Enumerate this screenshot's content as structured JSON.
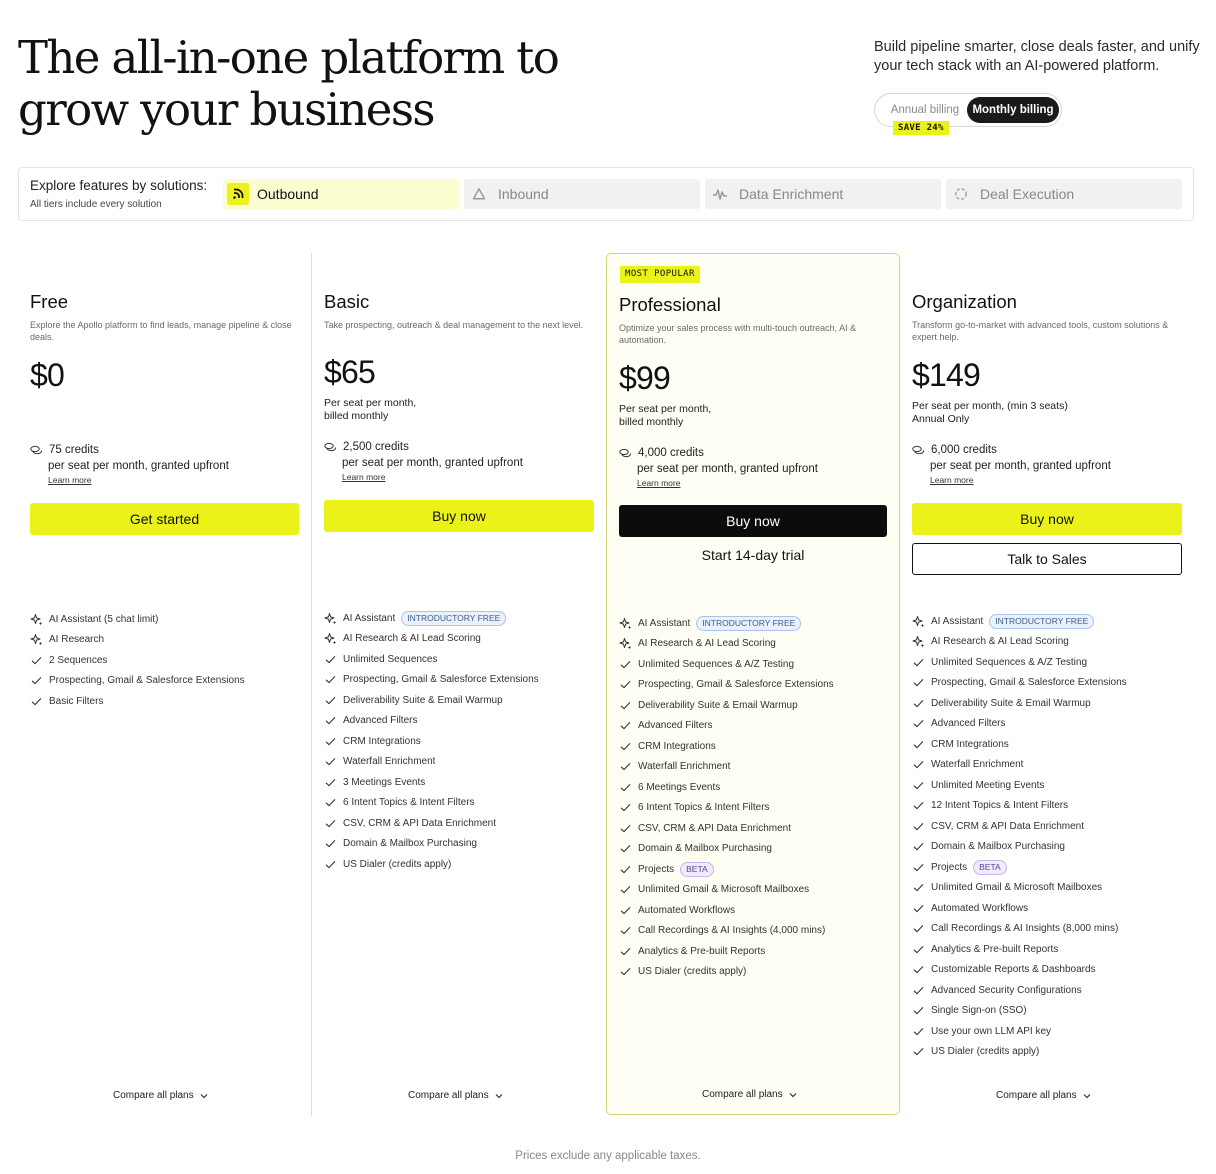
{
  "hero": {
    "title": "The all-in-one platform to grow your business",
    "subtitle": "Build pipeline smarter, close deals faster, and unify your tech stack with an AI-powered platform."
  },
  "billing": {
    "annual_label": "Annual billing",
    "monthly_label": "Monthly billing",
    "selected": "Monthly billing",
    "save_badge": "SAVE 24%"
  },
  "explore": {
    "title": "Explore features by solutions:",
    "note": "All tiers include every solution",
    "tabs": [
      {
        "label": "Outbound",
        "icon": "outbound-icon",
        "active": true
      },
      {
        "label": "Inbound",
        "icon": "inbound-icon",
        "active": false
      },
      {
        "label": "Data Enrichment",
        "icon": "data-enrichment-icon",
        "active": false
      },
      {
        "label": "Deal Execution",
        "icon": "deal-execution-icon",
        "active": false
      }
    ]
  },
  "plans": [
    {
      "name": "Free",
      "description": "Explore the Apollo platform to find leads, manage pipeline & close deals.",
      "price": "$0",
      "billed": "",
      "credits": "75 credits",
      "credits_note": "per seat per month, granted upfront",
      "learn_more": "Learn more",
      "primary_button": "Get started",
      "secondary_button": "",
      "compare": "Compare all plans",
      "features": [
        {
          "text": "AI Assistant (5 chat limit)",
          "icon": "sparkle-icon",
          "tag": ""
        },
        {
          "text": "AI Research",
          "icon": "sparkle-icon",
          "tag": ""
        },
        {
          "text": "2 Sequences",
          "icon": "check-icon",
          "tag": ""
        },
        {
          "text": "Prospecting, Gmail & Salesforce Extensions",
          "icon": "check-icon",
          "tag": ""
        },
        {
          "text": "Basic Filters",
          "icon": "check-icon",
          "tag": ""
        }
      ]
    },
    {
      "name": "Basic",
      "description": "Take prospecting, outreach & deal management to the next level.",
      "price": "$65",
      "billed": "Per seat per month,\nbilled monthly",
      "credits": "2,500 credits",
      "credits_note": "per seat per month, granted upfront",
      "learn_more": "Learn more",
      "primary_button": "Buy now",
      "secondary_button": "",
      "compare": "Compare all plans",
      "features": [
        {
          "text": "AI Assistant",
          "icon": "sparkle-icon",
          "tag": "INTRODUCTORY FREE"
        },
        {
          "text": "AI Research & AI Lead Scoring",
          "icon": "sparkle-icon",
          "tag": ""
        },
        {
          "text": "Unlimited Sequences",
          "icon": "check-icon",
          "tag": ""
        },
        {
          "text": "Prospecting, Gmail & Salesforce Extensions",
          "icon": "check-icon",
          "tag": ""
        },
        {
          "text": "Deliverability Suite & Email Warmup",
          "icon": "check-icon",
          "tag": ""
        },
        {
          "text": "Advanced Filters",
          "icon": "check-icon",
          "tag": ""
        },
        {
          "text": "CRM Integrations",
          "icon": "check-icon",
          "tag": ""
        },
        {
          "text": "Waterfall Enrichment",
          "icon": "check-icon",
          "tag": ""
        },
        {
          "text": "3 Meetings Events",
          "icon": "check-icon",
          "tag": ""
        },
        {
          "text": "6 Intent Topics & Intent Filters",
          "icon": "check-icon",
          "tag": ""
        },
        {
          "text": "CSV, CRM & API Data Enrichment",
          "icon": "check-icon",
          "tag": ""
        },
        {
          "text": "Domain & Mailbox Purchasing",
          "icon": "check-icon",
          "tag": ""
        },
        {
          "text": "US Dialer (credits apply)",
          "icon": "check-icon",
          "tag": ""
        }
      ]
    },
    {
      "name": "Professional",
      "badge": "MOST POPULAR",
      "description": "Optimize your sales process with multi-touch outreach, AI & automation.",
      "price": "$99",
      "billed": "Per seat per month,\nbilled monthly",
      "credits": "4,000 credits",
      "credits_note": "per seat per month, granted upfront",
      "learn_more": "Learn more",
      "primary_button": "Buy now",
      "secondary_button": "Start 14-day trial",
      "compare": "Compare all plans",
      "features": [
        {
          "text": "AI Assistant",
          "icon": "sparkle-icon",
          "tag": "INTRODUCTORY FREE"
        },
        {
          "text": "AI Research & AI Lead Scoring",
          "icon": "sparkle-icon",
          "tag": ""
        },
        {
          "text": "Unlimited Sequences & A/Z Testing",
          "icon": "check-icon",
          "tag": ""
        },
        {
          "text": "Prospecting, Gmail & Salesforce Extensions",
          "icon": "check-icon",
          "tag": ""
        },
        {
          "text": "Deliverability Suite & Email Warmup",
          "icon": "check-icon",
          "tag": ""
        },
        {
          "text": "Advanced Filters",
          "icon": "check-icon",
          "tag": ""
        },
        {
          "text": "CRM Integrations",
          "icon": "check-icon",
          "tag": ""
        },
        {
          "text": "Waterfall Enrichment",
          "icon": "check-icon",
          "tag": ""
        },
        {
          "text": "6 Meetings Events",
          "icon": "check-icon",
          "tag": ""
        },
        {
          "text": "6 Intent Topics & Intent Filters",
          "icon": "check-icon",
          "tag": ""
        },
        {
          "text": "CSV, CRM & API Data Enrichment",
          "icon": "check-icon",
          "tag": ""
        },
        {
          "text": "Domain & Mailbox Purchasing",
          "icon": "check-icon",
          "tag": ""
        },
        {
          "text": "Projects",
          "icon": "check-icon",
          "tag": "BETA"
        },
        {
          "text": "Unlimited Gmail & Microsoft Mailboxes",
          "icon": "check-icon",
          "tag": ""
        },
        {
          "text": "Automated Workflows",
          "icon": "check-icon",
          "tag": ""
        },
        {
          "text": "Call Recordings & AI Insights (4,000 mins)",
          "icon": "check-icon",
          "tag": ""
        },
        {
          "text": "Analytics & Pre-built Reports",
          "icon": "check-icon",
          "tag": ""
        },
        {
          "text": "US Dialer (credits apply)",
          "icon": "check-icon",
          "tag": ""
        }
      ]
    },
    {
      "name": "Organization",
      "description": "Transform go-to-market with advanced tools, custom solutions & expert help.",
      "price": "$149",
      "billed": "Per seat per month, (min 3 seats)\nAnnual Only",
      "credits": "6,000 credits",
      "credits_note": "per seat per month, granted upfront",
      "learn_more": "Learn more",
      "primary_button": "Buy now",
      "secondary_button": "Talk to Sales",
      "compare": "Compare all plans",
      "features": [
        {
          "text": "AI Assistant",
          "icon": "sparkle-icon",
          "tag": "INTRODUCTORY FREE"
        },
        {
          "text": "AI Research & AI Lead Scoring",
          "icon": "sparkle-icon",
          "tag": ""
        },
        {
          "text": "Unlimited Sequences & A/Z Testing",
          "icon": "check-icon",
          "tag": ""
        },
        {
          "text": "Prospecting, Gmail & Salesforce Extensions",
          "icon": "check-icon",
          "tag": ""
        },
        {
          "text": "Deliverability Suite & Email Warmup",
          "icon": "check-icon",
          "tag": ""
        },
        {
          "text": "Advanced Filters",
          "icon": "check-icon",
          "tag": ""
        },
        {
          "text": "CRM Integrations",
          "icon": "check-icon",
          "tag": ""
        },
        {
          "text": "Waterfall Enrichment",
          "icon": "check-icon",
          "tag": ""
        },
        {
          "text": "Unlimited Meeting Events",
          "icon": "check-icon",
          "tag": ""
        },
        {
          "text": "12 Intent Topics & Intent Filters",
          "icon": "check-icon",
          "tag": ""
        },
        {
          "text": "CSV, CRM & API Data Enrichment",
          "icon": "check-icon",
          "tag": ""
        },
        {
          "text": "Domain & Mailbox Purchasing",
          "icon": "check-icon",
          "tag": ""
        },
        {
          "text": "Projects",
          "icon": "check-icon",
          "tag": "BETA"
        },
        {
          "text": "Unlimited Gmail & Microsoft Mailboxes",
          "icon": "check-icon",
          "tag": ""
        },
        {
          "text": "Automated Workflows",
          "icon": "check-icon",
          "tag": ""
        },
        {
          "text": "Call Recordings & AI Insights (8,000 mins)",
          "icon": "check-icon",
          "tag": ""
        },
        {
          "text": "Analytics & Pre-built Reports",
          "icon": "check-icon",
          "tag": ""
        },
        {
          "text": "Customizable Reports & Dashboards",
          "icon": "check-icon",
          "tag": ""
        },
        {
          "text": "Advanced Security Configurations",
          "icon": "check-icon",
          "tag": ""
        },
        {
          "text": "Single Sign-on (SSO)",
          "icon": "check-icon",
          "tag": ""
        },
        {
          "text": "Use your own LLM API key",
          "icon": "check-icon",
          "tag": ""
        },
        {
          "text": "US Dialer (credits apply)",
          "icon": "check-icon",
          "tag": ""
        }
      ]
    }
  ],
  "footnote": "Prices exclude any applicable taxes.",
  "colors": {
    "accent_yellow": "#eaf21a",
    "featured_bg": "#fffef4",
    "featured_border": "#d9d67a",
    "tag_blue": "#e9f1fc",
    "tag_purple": "#f1ecfb"
  }
}
